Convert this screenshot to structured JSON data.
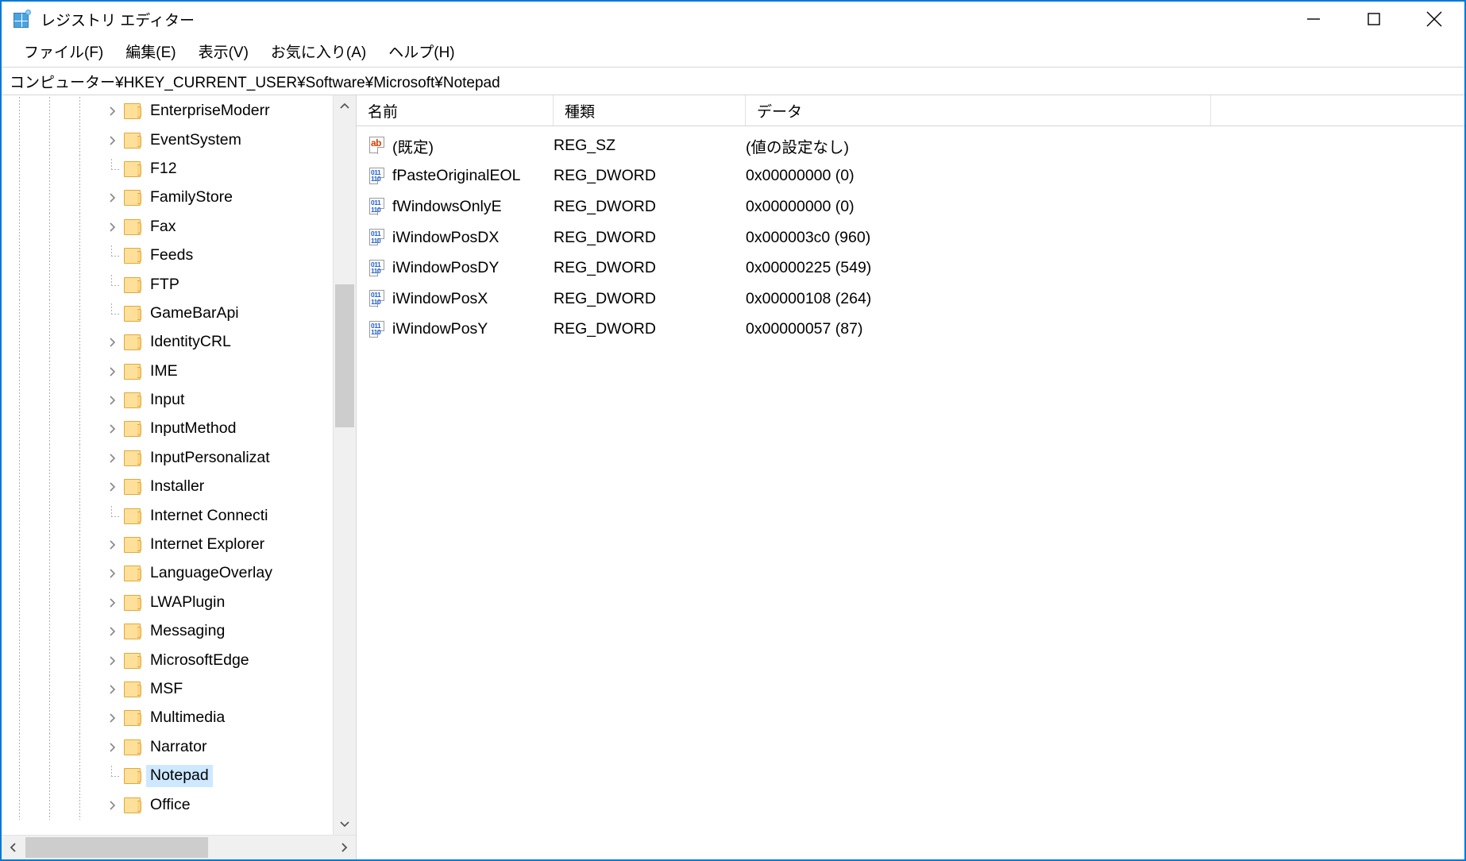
{
  "window": {
    "title": "レジストリ エディター",
    "app_icon": "registry-editor-icon",
    "controls": {
      "minimize": "minimize-icon",
      "maximize": "maximize-icon",
      "close": "close-icon"
    }
  },
  "menubar": {
    "items": [
      {
        "label": "ファイル(F)",
        "name": "menu-file"
      },
      {
        "label": "編集(E)",
        "name": "menu-edit"
      },
      {
        "label": "表示(V)",
        "name": "menu-view"
      },
      {
        "label": "お気に入り(A)",
        "name": "menu-favorites"
      },
      {
        "label": "ヘルプ(H)",
        "name": "menu-help"
      }
    ]
  },
  "address": {
    "path": "コンピューター¥HKEY_CURRENT_USER¥Software¥Microsoft¥Notepad"
  },
  "tree": {
    "items": [
      {
        "label": "EnterpriseModerr",
        "expandable": true,
        "selected": false
      },
      {
        "label": "EventSystem",
        "expandable": true,
        "selected": false
      },
      {
        "label": "F12",
        "expandable": false,
        "selected": false
      },
      {
        "label": "FamilyStore",
        "expandable": true,
        "selected": false
      },
      {
        "label": "Fax",
        "expandable": true,
        "selected": false
      },
      {
        "label": "Feeds",
        "expandable": false,
        "selected": false
      },
      {
        "label": "FTP",
        "expandable": false,
        "selected": false
      },
      {
        "label": "GameBarApi",
        "expandable": false,
        "selected": false
      },
      {
        "label": "IdentityCRL",
        "expandable": true,
        "selected": false
      },
      {
        "label": "IME",
        "expandable": true,
        "selected": false
      },
      {
        "label": "Input",
        "expandable": true,
        "selected": false
      },
      {
        "label": "InputMethod",
        "expandable": true,
        "selected": false
      },
      {
        "label": "InputPersonalizat",
        "expandable": true,
        "selected": false
      },
      {
        "label": "Installer",
        "expandable": true,
        "selected": false
      },
      {
        "label": "Internet Connecti",
        "expandable": false,
        "selected": false
      },
      {
        "label": "Internet Explorer",
        "expandable": true,
        "selected": false
      },
      {
        "label": "LanguageOverlay",
        "expandable": true,
        "selected": false
      },
      {
        "label": "LWAPlugin",
        "expandable": true,
        "selected": false
      },
      {
        "label": "Messaging",
        "expandable": true,
        "selected": false
      },
      {
        "label": "MicrosoftEdge",
        "expandable": true,
        "selected": false
      },
      {
        "label": "MSF",
        "expandable": true,
        "selected": false
      },
      {
        "label": "Multimedia",
        "expandable": true,
        "selected": false
      },
      {
        "label": "Narrator",
        "expandable": true,
        "selected": false
      },
      {
        "label": "Notepad",
        "expandable": false,
        "selected": true
      },
      {
        "label": "Office",
        "expandable": true,
        "selected": false
      }
    ],
    "scrollbars": {
      "up_arrow": "chevron-up-icon",
      "down_arrow": "chevron-down-icon",
      "left_arrow": "chevron-left-icon",
      "right_arrow": "chevron-right-icon"
    }
  },
  "values": {
    "columns": [
      {
        "label": "名前",
        "name": "column-header-name"
      },
      {
        "label": "種類",
        "name": "column-header-type"
      },
      {
        "label": "データ",
        "name": "column-header-data"
      }
    ],
    "rows": [
      {
        "icon": "string-value-icon",
        "icon_kind": "sz",
        "name": "(既定)",
        "type": "REG_SZ",
        "data": "(値の設定なし)"
      },
      {
        "icon": "dword-value-icon",
        "icon_kind": "dword",
        "name": "fPasteOriginalEOL",
        "type": "REG_DWORD",
        "data": "0x00000000 (0)"
      },
      {
        "icon": "dword-value-icon",
        "icon_kind": "dword",
        "name": "fWindowsOnlyE",
        "type": "REG_DWORD",
        "data": "0x00000000 (0)"
      },
      {
        "icon": "dword-value-icon",
        "icon_kind": "dword",
        "name": "iWindowPosDX",
        "type": "REG_DWORD",
        "data": "0x000003c0 (960)"
      },
      {
        "icon": "dword-value-icon",
        "icon_kind": "dword",
        "name": "iWindowPosDY",
        "type": "REG_DWORD",
        "data": "0x00000225 (549)"
      },
      {
        "icon": "dword-value-icon",
        "icon_kind": "dword",
        "name": "iWindowPosX",
        "type": "REG_DWORD",
        "data": "0x00000108 (264)"
      },
      {
        "icon": "dword-value-icon",
        "icon_kind": "dword",
        "name": "iWindowPosY",
        "type": "REG_DWORD",
        "data": "0x00000057 (87)"
      }
    ]
  },
  "colors": {
    "window_border": "#0078d7",
    "selection": "#cde8ff",
    "folder_fill": "#ffe09a",
    "folder_edge": "#e0a83a",
    "scrollbar_thumb": "#cdcdcd"
  }
}
